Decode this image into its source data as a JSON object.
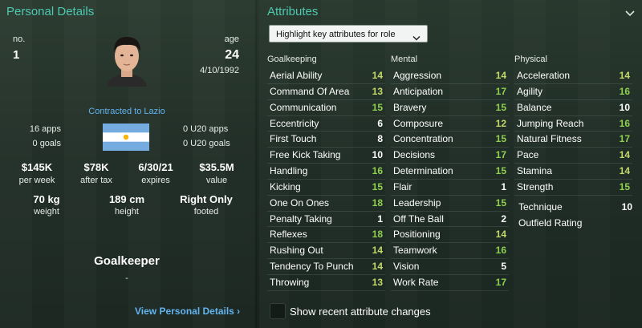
{
  "personal": {
    "title": "Personal Details",
    "number_label": "no.",
    "number": "1",
    "age_label": "age",
    "age": "24",
    "dob": "4/10/1992",
    "contract": "Contracted to Lazio",
    "apps": "16 apps",
    "goals": "0 goals",
    "u20_apps": "0 U20 apps",
    "u20_goals": "0 U20 goals",
    "wage_value": "$145K",
    "wage_label": "per week",
    "after_tax_value": "$78K",
    "after_tax_label": "after tax",
    "expires_value": "6/30/21",
    "expires_label": "expires",
    "value_value": "$35.5M",
    "value_label": "value",
    "weight_value": "70 kg",
    "weight_label": "weight",
    "height_value": "189 cm",
    "height_label": "height",
    "foot_value": "Right Only",
    "foot_label": "footed",
    "position": "Goalkeeper",
    "position_sub": "-",
    "link": "View Personal Details ›"
  },
  "attributes": {
    "title": "Attributes",
    "dropdown": "Highlight key attributes for role",
    "goalkeeping_title": "Goalkeeping",
    "mental_title": "Mental",
    "physical_title": "Physical",
    "goalkeeping": [
      {
        "name": "Aerial Ability",
        "value": "14"
      },
      {
        "name": "Command Of Area",
        "value": "13"
      },
      {
        "name": "Communication",
        "value": "15"
      },
      {
        "name": "Eccentricity",
        "value": "6"
      },
      {
        "name": "First Touch",
        "value": "8"
      },
      {
        "name": "Free Kick Taking",
        "value": "10"
      },
      {
        "name": "Handling",
        "value": "16"
      },
      {
        "name": "Kicking",
        "value": "15"
      },
      {
        "name": "One On Ones",
        "value": "18"
      },
      {
        "name": "Penalty Taking",
        "value": "1"
      },
      {
        "name": "Reflexes",
        "value": "18"
      },
      {
        "name": "Rushing Out",
        "value": "14"
      },
      {
        "name": "Tendency To Punch",
        "value": "14"
      },
      {
        "name": "Throwing",
        "value": "13"
      }
    ],
    "mental": [
      {
        "name": "Aggression",
        "value": "14"
      },
      {
        "name": "Anticipation",
        "value": "17"
      },
      {
        "name": "Bravery",
        "value": "15"
      },
      {
        "name": "Composure",
        "value": "12"
      },
      {
        "name": "Concentration",
        "value": "15"
      },
      {
        "name": "Decisions",
        "value": "17"
      },
      {
        "name": "Determination",
        "value": "15"
      },
      {
        "name": "Flair",
        "value": "1"
      },
      {
        "name": "Leadership",
        "value": "15"
      },
      {
        "name": "Off The Ball",
        "value": "2"
      },
      {
        "name": "Positioning",
        "value": "14"
      },
      {
        "name": "Teamwork",
        "value": "16"
      },
      {
        "name": "Vision",
        "value": "5"
      },
      {
        "name": "Work Rate",
        "value": "17"
      }
    ],
    "physical": [
      {
        "name": "Acceleration",
        "value": "14"
      },
      {
        "name": "Agility",
        "value": "16"
      },
      {
        "name": "Balance",
        "value": "10"
      },
      {
        "name": "Jumping Reach",
        "value": "16"
      },
      {
        "name": "Natural Fitness",
        "value": "17"
      },
      {
        "name": "Pace",
        "value": "14"
      },
      {
        "name": "Stamina",
        "value": "14"
      },
      {
        "name": "Strength",
        "value": "15"
      }
    ],
    "technique_label": "Technique",
    "technique_value": "10",
    "outfield_label": "Outfield Rating",
    "checkbox_label": "Show recent attribute changes"
  },
  "colors": {
    "accent": "#4dc9b0",
    "link": "#62b4f0",
    "value_high": "#8fd14f",
    "value_mid": "#c5d86a",
    "value_low": "#ffffff"
  }
}
